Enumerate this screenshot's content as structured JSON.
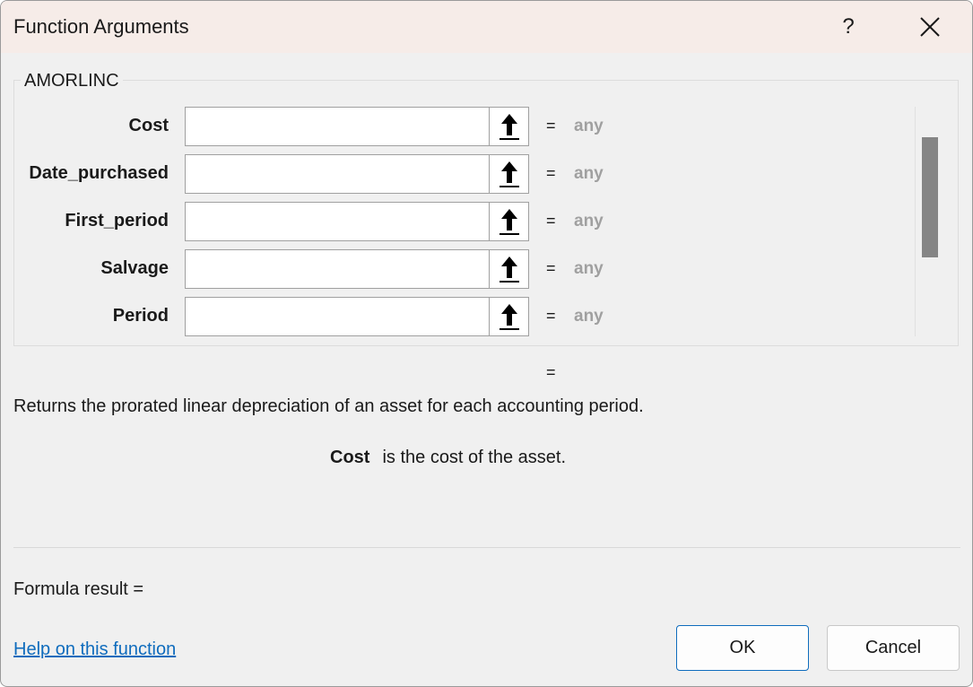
{
  "window": {
    "title": "Function Arguments",
    "help_glyph": "?",
    "close_icon": "close-icon"
  },
  "function": {
    "name": "AMORLINC",
    "arguments": [
      {
        "label": "Cost",
        "value": "",
        "equals": "=",
        "result": "any"
      },
      {
        "label": "Date_purchased",
        "value": "",
        "equals": "=",
        "result": "any"
      },
      {
        "label": "First_period",
        "value": "",
        "equals": "=",
        "result": "any"
      },
      {
        "label": "Salvage",
        "value": "",
        "equals": "=",
        "result": "any"
      },
      {
        "label": "Period",
        "value": "",
        "equals": "=",
        "result": "any"
      }
    ],
    "result_equals": "=",
    "description": "Returns the prorated linear depreciation of an asset for each accounting period.",
    "arg_help": {
      "name": "Cost",
      "text": "is the cost of the asset."
    }
  },
  "footer": {
    "formula_result": "Formula result =",
    "help_link": "Help on this function",
    "ok_label": "OK",
    "cancel_label": "Cancel"
  },
  "colors": {
    "titlebar": "#f6ece8",
    "dialog_bg": "#f0f0f0",
    "link": "#0f6cbd",
    "muted_value": "#a0a0a0",
    "ok_border": "#0f6cbd"
  }
}
